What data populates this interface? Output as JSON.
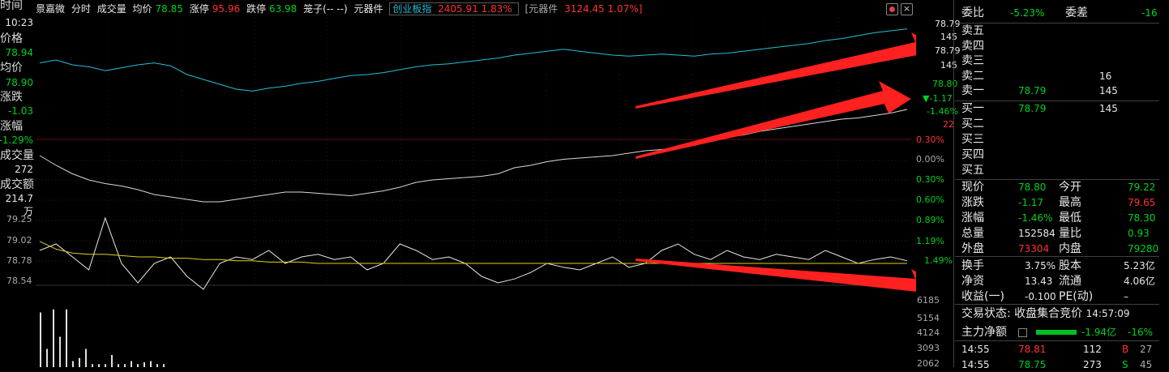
{
  "header": {
    "stock_name": "景嘉微",
    "mode": "分时",
    "volume_label": "成交量",
    "avg_label": "均价",
    "avg_value": "78.85",
    "limit_up_label": "涨停",
    "limit_up_value": "95.96",
    "limit_down_label": "跌停",
    "limit_down_value": "63.98",
    "cage_label": "笼子(-- --)",
    "sector_label": "元器件",
    "index_name": "创业板指",
    "index_value": "2405.91 1.83%",
    "sector_index_name": "[元器件",
    "sector_index_value": "3124.45 1.07%]"
  },
  "left_panel": {
    "time_label": "时间",
    "time_value": "10:23",
    "price_label": "价格",
    "price_value": "78.94",
    "avg_label": "均价",
    "avg_value": "78.90",
    "change_label": "涨跌",
    "change_value": "-1.03",
    "pct_label": "涨幅",
    "pct_value": "-1.29%",
    "volume_label": "成交量",
    "volume_value": "272",
    "amount_label": "成交额",
    "amount_value": "214.7万"
  },
  "axis": {
    "right_main_ticks": [
      "78.79",
      "145",
      "78.79",
      "145",
      "78.80",
      "-1.17",
      "-1.46%",
      "22",
      "0.30%",
      "0.00%",
      "0.30%",
      "0.60%",
      "0.89%",
      "1.19%",
      "1.49%"
    ],
    "left_lower_ticks": [
      "79.25",
      "79.02",
      "78.78",
      "78.54"
    ],
    "volume_ticks": [
      "6185",
      "5154",
      "4124",
      "3093",
      "2062"
    ]
  },
  "chart_data": {
    "type": "line",
    "series": [
      {
        "values": [
          0.62,
          0.65,
          0.6,
          0.58,
          0.54,
          0.57,
          0.6,
          0.62,
          0.59,
          0.5,
          0.45,
          0.4,
          0.35,
          0.33,
          0.36,
          0.38,
          0.41,
          0.43,
          0.46,
          0.49,
          0.5,
          0.52,
          0.55,
          0.58,
          0.6,
          0.61,
          0.63,
          0.65,
          0.67,
          0.7,
          0.72,
          0.74,
          0.76,
          0.74,
          0.72,
          0.7,
          0.69,
          0.7,
          0.71,
          0.7,
          0.69,
          0.71,
          0.72,
          0.74,
          0.76,
          0.78,
          0.8,
          0.82,
          0.85,
          0.87,
          0.9,
          0.93,
          0.95,
          0.97
        ]
      },
      {
        "values": [
          0.5,
          0.42,
          0.35,
          0.3,
          0.27,
          0.25,
          0.22,
          0.18,
          0.16,
          0.14,
          0.12,
          0.12,
          0.14,
          0.16,
          0.18,
          0.2,
          0.2,
          0.19,
          0.18,
          0.17,
          0.19,
          0.21,
          0.24,
          0.28,
          0.3,
          0.31,
          0.32,
          0.33,
          0.35,
          0.4,
          0.42,
          0.45,
          0.47,
          0.48,
          0.49,
          0.5,
          0.52,
          0.54,
          0.55,
          0.57,
          0.6,
          0.62,
          0.65,
          0.67,
          0.7,
          0.72,
          0.74,
          0.76,
          0.78,
          0.8,
          0.81,
          0.83,
          0.85,
          0.88
        ]
      },
      {
        "values": [
          0.55,
          0.6,
          0.5,
          0.4,
          0.8,
          0.45,
          0.3,
          0.45,
          0.5,
          0.35,
          0.25,
          0.45,
          0.5,
          0.48,
          0.55,
          0.45,
          0.5,
          0.52,
          0.48,
          0.5,
          0.4,
          0.45,
          0.6,
          0.55,
          0.48,
          0.5,
          0.45,
          0.35,
          0.3,
          0.33,
          0.38,
          0.45,
          0.42,
          0.4,
          0.45,
          0.5,
          0.42,
          0.45,
          0.55,
          0.6,
          0.52,
          0.48,
          0.55,
          0.5,
          0.48,
          0.52,
          0.5,
          0.48,
          0.55,
          0.5,
          0.45,
          0.48,
          0.5,
          0.47
        ]
      },
      {
        "values": [
          0.62,
          0.56,
          0.53,
          0.52,
          0.52,
          0.51,
          0.5,
          0.5,
          0.49,
          0.49,
          0.48,
          0.48,
          0.47,
          0.47,
          0.46,
          0.46,
          0.46,
          0.45,
          0.45,
          0.45,
          0.45,
          0.45,
          0.45,
          0.45,
          0.45,
          0.45,
          0.45,
          0.45,
          0.45,
          0.45,
          0.45,
          0.45,
          0.45,
          0.45,
          0.45,
          0.45,
          0.45,
          0.45,
          0.45,
          0.45,
          0.45,
          0.45,
          0.45,
          0.45,
          0.45,
          0.45,
          0.45,
          0.45,
          0.45,
          0.45,
          0.45,
          0.45,
          0.45,
          0.45
        ]
      }
    ],
    "volume_values": [
      0.9,
      0.3,
      0.95,
      0.5,
      0.95,
      0.1,
      0.15,
      0.3,
      0.05,
      0.05,
      0.05,
      0.2,
      0.05,
      0.05,
      0.1,
      0.05,
      0.08,
      0.1,
      0.05,
      0.05
    ]
  },
  "right_panel": {
    "order_ratio_label": "委比",
    "order_ratio_value": "-5.23%",
    "order_diff_label": "委差",
    "order_diff_value": "-16",
    "asks": [
      {
        "label": "卖五",
        "price": "",
        "vol": ""
      },
      {
        "label": "卖四",
        "price": "",
        "vol": ""
      },
      {
        "label": "卖三",
        "price": "",
        "vol": ""
      },
      {
        "label": "卖二",
        "price": "",
        "vol": "16"
      },
      {
        "label": "卖一",
        "price": "78.79",
        "vol": "145"
      }
    ],
    "bids": [
      {
        "label": "买一",
        "price": "78.79",
        "vol": "145"
      },
      {
        "label": "买二",
        "price": "",
        "vol": ""
      },
      {
        "label": "买三",
        "price": "",
        "vol": ""
      },
      {
        "label": "买四",
        "price": "",
        "vol": ""
      },
      {
        "label": "买五",
        "price": "",
        "vol": ""
      }
    ],
    "quote": [
      {
        "l1": "现价",
        "v1": "78.80",
        "l2": "今开",
        "v2": "79.22"
      },
      {
        "l1": "涨跌",
        "v1": "-1.17",
        "l2": "最高",
        "v2": "79.65"
      },
      {
        "l1": "涨幅",
        "v1": "-1.46%",
        "l2": "最低",
        "v2": "78.30"
      },
      {
        "l1": "总量",
        "v1": "152584",
        "l2": "量比",
        "v2": "0.93"
      },
      {
        "l1": "外盘",
        "v1": "73304",
        "l2": "内盘",
        "v2": "79280"
      }
    ],
    "fin": [
      {
        "l1": "换手",
        "v1": "3.75%",
        "l2": "股本",
        "v2": "5.23亿"
      },
      {
        "l1": "净资",
        "v1": "13.43",
        "l2": "流通",
        "v2": "4.06亿"
      },
      {
        "l1": "收益(一)",
        "v1": "-0.100",
        "l2": "PE(动)",
        "v2": "–"
      }
    ],
    "status_label": "交易状态:",
    "status_value": "收盘集合竞价",
    "status_time": "14:57:09",
    "main_flow_label": "主力净额",
    "main_flow_value": "-1.94亿",
    "main_flow_pct": "-16%",
    "ticks": [
      {
        "time": "14:55",
        "price": "78.81",
        "vol": "112",
        "side": "B",
        "count": "27"
      },
      {
        "time": "14:55",
        "price": "78.75",
        "vol": "273",
        "side": "S",
        "count": "45"
      }
    ]
  }
}
